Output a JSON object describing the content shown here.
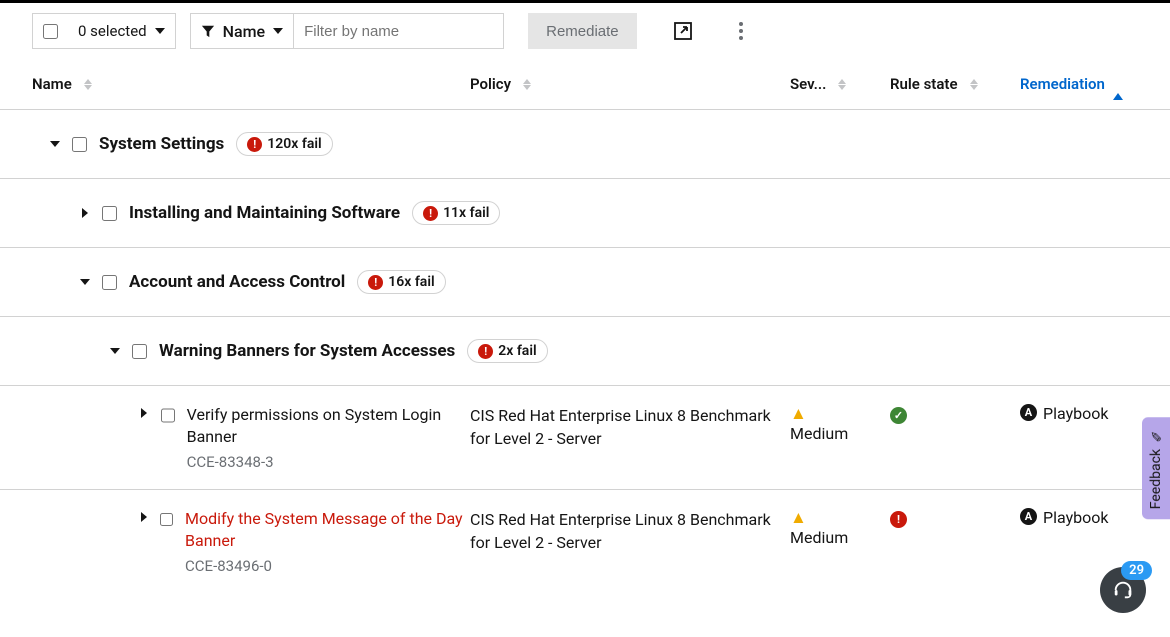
{
  "toolbar": {
    "selected_text": "0 selected",
    "filter_type_label": "Name",
    "filter_placeholder": "Filter by name",
    "remediate_label": "Remediate"
  },
  "columns": {
    "name": "Name",
    "policy": "Policy",
    "severity": "Sev...",
    "rule_state": "Rule state",
    "remediation": "Remediation"
  },
  "groups": {
    "g0": {
      "title": "System Settings",
      "fail": "120x fail"
    },
    "g1": {
      "title": "Installing and Maintaining Software",
      "fail": "11x fail"
    },
    "g2": {
      "title": "Account and Access Control",
      "fail": "16x fail"
    },
    "g3": {
      "title": "Warning Banners for System Accesses",
      "fail": "2x fail"
    }
  },
  "rules": {
    "r0": {
      "name": "Verify permissions on System Login Banner",
      "cce": "CCE-83348-3",
      "policy": "CIS Red Hat Enterprise Linux 8 Benchmark for Level 2 - Server",
      "severity": "Medium",
      "remediation": "Playbook"
    },
    "r1": {
      "name": "Modify the System Message of the Day Banner",
      "cce": "CCE-83496-0",
      "policy": "CIS Red Hat Enterprise Linux 8 Benchmark for Level 2 - Server",
      "severity": "Medium",
      "remediation": "Playbook"
    }
  },
  "feedback_label": "Feedback",
  "fab_badge": "29"
}
